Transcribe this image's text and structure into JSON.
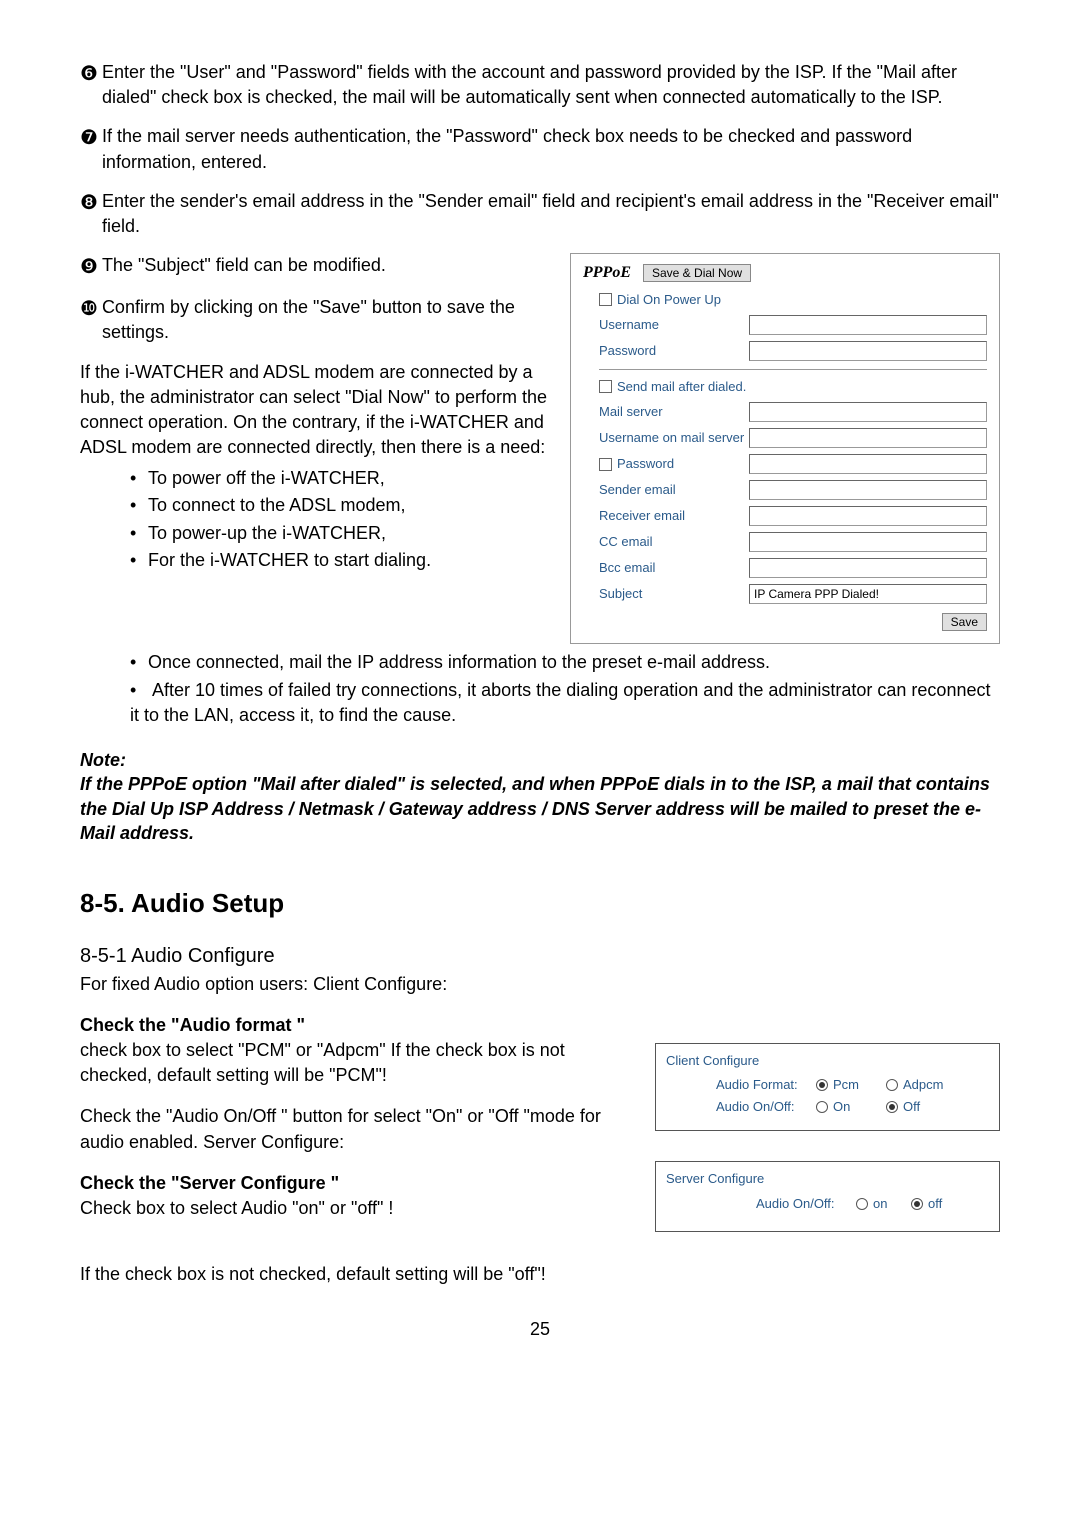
{
  "bullets": {
    "b6": "Enter the \"User\" and \"Password\" fields with the account and password provided by the ISP. If the \"Mail after dialed\" check box is checked, the mail will be automatically sent when connected automatically to the ISP.",
    "b7": "If the mail server needs authentication, the \"Password\" check box needs to be checked and password information, entered.",
    "b8": "Enter the sender's email address in the \"Sender email\" field and recipient's email address in the \"Receiver email\" field.",
    "b9": "The \"Subject\" field can be modified.",
    "b10": "Confirm by clicking on the \"Save\" button to save the settings."
  },
  "symbols": {
    "b6": "❻",
    "b7": "❼",
    "b8": "❽",
    "b9": "❾",
    "b10": "❿"
  },
  "conn_text": "If the i-WATCHER and ADSL modem are connected   by a hub, the administrator can select \"Dial Now\" to perform the connect operation. On the contrary, if the i-WATCHER and ADSL modem are connected directly, then there is a need:",
  "sub": {
    "s1": "To power off the i-WATCHER,",
    "s2": "To connect to the ADSL modem,",
    "s3": "To power-up the i-WATCHER,",
    "s4": "For the i-WATCHER to start dialing.",
    "s5": "Once connected, mail the IP address information to the preset e-mail address.",
    "s6": " After 10 times of failed try connections, it aborts the dialing operation and the administrator can reconnect it to the LAN, access it, to find the cause."
  },
  "note": {
    "head": "Note:",
    "body": "If the PPPoE option \"Mail after dialed\" is selected, and when PPPoE dials in to the ISP, a mail that contains the Dial Up ISP Address / Netmask / Gateway address / DNS Server address will be mailed to preset the e-Mail address."
  },
  "section_title": "8-5. Audio Setup",
  "audio": {
    "subtitle": "8-5-1 Audio Configure",
    "intro": "For fixed Audio option users: Client Configure:",
    "h1": "Check the \"Audio format \"",
    "p1": "check box to select \"PCM\" or \"Adpcm\" If the check box is not checked, default setting will be \"PCM\"!",
    "p2": "Check the \"Audio On/Off \" button for select \"On\" or \"Off \"mode for audio enabled. Server Configure:",
    "h2": "Check the \"Server Configure \"",
    "p3a": "Chec",
    "p3b": " box to select Audio \"on\" or \"off\" !",
    "p4": "If the check box is not checked, default setting will be \"off\"!"
  },
  "pppoe": {
    "title": "PPPoE",
    "dial_btn": "Save & Dial Now",
    "dial_on_power": "Dial On Power Up",
    "username": "Username",
    "password": "Password",
    "send_after": "Send mail after dialed.",
    "mail_server": "Mail server",
    "user_on_mail": "Username on mail server",
    "mail_pwd": "Password",
    "sender": "Sender email",
    "receiver": "Receiver email",
    "cc": "CC email",
    "bcc": "Bcc email",
    "subject": "Subject",
    "subject_val": "IP Camera PPP Dialed!",
    "save": "Save"
  },
  "client_box": {
    "title": "Client Configure",
    "fmt_label": "Audio Format:",
    "fmt_pcm": "Pcm",
    "fmt_adpcm": "Adpcm",
    "onoff_label": "Audio On/Off:",
    "on": "On",
    "off": "Off"
  },
  "server_box": {
    "title": "Server Configure",
    "onoff_label": "Audio On/Off:",
    "on": "on",
    "off": "off"
  },
  "page_num": "25"
}
